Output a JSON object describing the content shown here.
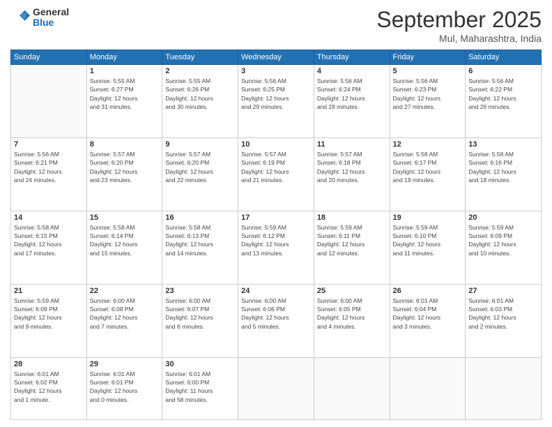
{
  "header": {
    "logo_general": "General",
    "logo_blue": "Blue",
    "month_title": "September 2025",
    "subtitle": "Mul, Maharashtra, India"
  },
  "days_of_week": [
    "Sunday",
    "Monday",
    "Tuesday",
    "Wednesday",
    "Thursday",
    "Friday",
    "Saturday"
  ],
  "weeks": [
    [
      {
        "day": "",
        "info": ""
      },
      {
        "day": "1",
        "info": "Sunrise: 5:55 AM\nSunset: 6:27 PM\nDaylight: 12 hours\nand 31 minutes."
      },
      {
        "day": "2",
        "info": "Sunrise: 5:55 AM\nSunset: 6:26 PM\nDaylight: 12 hours\nand 30 minutes."
      },
      {
        "day": "3",
        "info": "Sunrise: 5:56 AM\nSunset: 6:25 PM\nDaylight: 12 hours\nand 29 minutes."
      },
      {
        "day": "4",
        "info": "Sunrise: 5:56 AM\nSunset: 6:24 PM\nDaylight: 12 hours\nand 28 minutes."
      },
      {
        "day": "5",
        "info": "Sunrise: 5:56 AM\nSunset: 6:23 PM\nDaylight: 12 hours\nand 27 minutes."
      },
      {
        "day": "6",
        "info": "Sunrise: 5:56 AM\nSunset: 6:22 PM\nDaylight: 12 hours\nand 26 minutes."
      }
    ],
    [
      {
        "day": "7",
        "info": "Sunrise: 5:56 AM\nSunset: 6:21 PM\nDaylight: 12 hours\nand 24 minutes."
      },
      {
        "day": "8",
        "info": "Sunrise: 5:57 AM\nSunset: 6:20 PM\nDaylight: 12 hours\nand 23 minutes."
      },
      {
        "day": "9",
        "info": "Sunrise: 5:57 AM\nSunset: 6:20 PM\nDaylight: 12 hours\nand 22 minutes."
      },
      {
        "day": "10",
        "info": "Sunrise: 5:57 AM\nSunset: 6:19 PM\nDaylight: 12 hours\nand 21 minutes."
      },
      {
        "day": "11",
        "info": "Sunrise: 5:57 AM\nSunset: 6:18 PM\nDaylight: 12 hours\nand 20 minutes."
      },
      {
        "day": "12",
        "info": "Sunrise: 5:58 AM\nSunset: 6:17 PM\nDaylight: 12 hours\nand 19 minutes."
      },
      {
        "day": "13",
        "info": "Sunrise: 5:58 AM\nSunset: 6:16 PM\nDaylight: 12 hours\nand 18 minutes."
      }
    ],
    [
      {
        "day": "14",
        "info": "Sunrise: 5:58 AM\nSunset: 6:15 PM\nDaylight: 12 hours\nand 17 minutes."
      },
      {
        "day": "15",
        "info": "Sunrise: 5:58 AM\nSunset: 6:14 PM\nDaylight: 12 hours\nand 15 minutes."
      },
      {
        "day": "16",
        "info": "Sunrise: 5:58 AM\nSunset: 6:13 PM\nDaylight: 12 hours\nand 14 minutes."
      },
      {
        "day": "17",
        "info": "Sunrise: 5:59 AM\nSunset: 6:12 PM\nDaylight: 12 hours\nand 13 minutes."
      },
      {
        "day": "18",
        "info": "Sunrise: 5:59 AM\nSunset: 6:11 PM\nDaylight: 12 hours\nand 12 minutes."
      },
      {
        "day": "19",
        "info": "Sunrise: 5:59 AM\nSunset: 6:10 PM\nDaylight: 12 hours\nand 11 minutes."
      },
      {
        "day": "20",
        "info": "Sunrise: 5:59 AM\nSunset: 6:09 PM\nDaylight: 12 hours\nand 10 minutes."
      }
    ],
    [
      {
        "day": "21",
        "info": "Sunrise: 5:59 AM\nSunset: 6:09 PM\nDaylight: 12 hours\nand 9 minutes."
      },
      {
        "day": "22",
        "info": "Sunrise: 6:00 AM\nSunset: 6:08 PM\nDaylight: 12 hours\nand 7 minutes."
      },
      {
        "day": "23",
        "info": "Sunrise: 6:00 AM\nSunset: 6:07 PM\nDaylight: 12 hours\nand 6 minutes."
      },
      {
        "day": "24",
        "info": "Sunrise: 6:00 AM\nSunset: 6:06 PM\nDaylight: 12 hours\nand 5 minutes."
      },
      {
        "day": "25",
        "info": "Sunrise: 6:00 AM\nSunset: 6:05 PM\nDaylight: 12 hours\nand 4 minutes."
      },
      {
        "day": "26",
        "info": "Sunrise: 6:01 AM\nSunset: 6:04 PM\nDaylight: 12 hours\nand 3 minutes."
      },
      {
        "day": "27",
        "info": "Sunrise: 6:01 AM\nSunset: 6:03 PM\nDaylight: 12 hours\nand 2 minutes."
      }
    ],
    [
      {
        "day": "28",
        "info": "Sunrise: 6:01 AM\nSunset: 6:02 PM\nDaylight: 12 hours\nand 1 minute."
      },
      {
        "day": "29",
        "info": "Sunrise: 6:01 AM\nSunset: 6:01 PM\nDaylight: 12 hours\nand 0 minutes."
      },
      {
        "day": "30",
        "info": "Sunrise: 6:01 AM\nSunset: 6:00 PM\nDaylight: 11 hours\nand 58 minutes."
      },
      {
        "day": "",
        "info": ""
      },
      {
        "day": "",
        "info": ""
      },
      {
        "day": "",
        "info": ""
      },
      {
        "day": "",
        "info": ""
      }
    ]
  ]
}
